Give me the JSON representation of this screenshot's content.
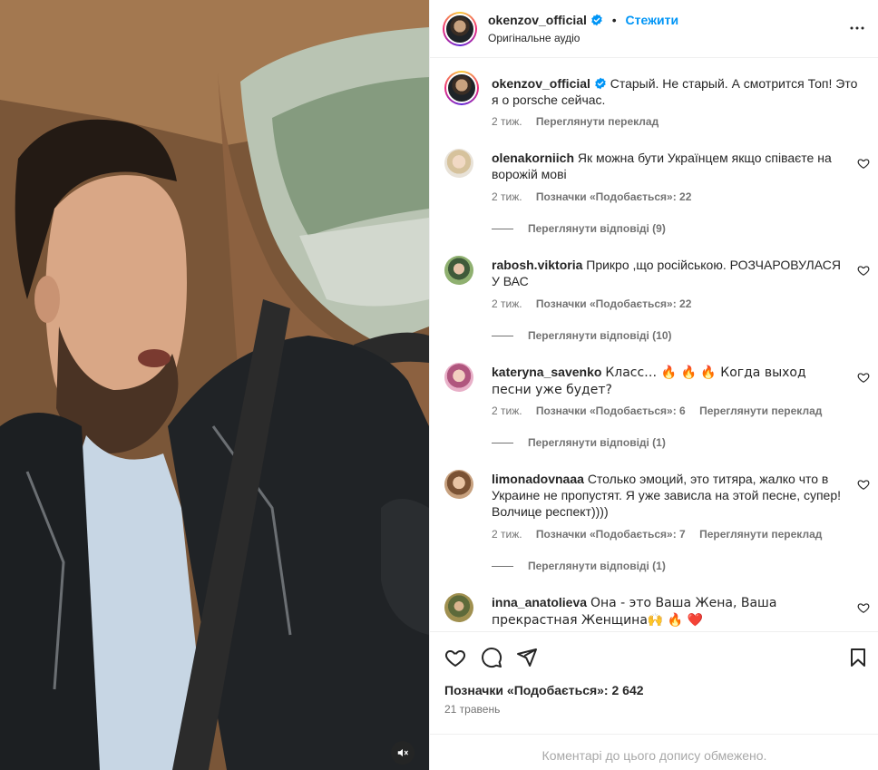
{
  "post": {
    "author": "okenzov_official",
    "follow_label": "Стежити",
    "audio_label": "Оригінальне аудіо"
  },
  "caption": {
    "username": "okenzov_official",
    "text": "Старый. Не старый. А смотрится Топ! Это я о porsche сейчас.",
    "time": "2 тиж.",
    "translate_label": "Переглянути переклад"
  },
  "comments": [
    {
      "username": "olenakorniich",
      "text": "Як можна бути Українцем якщо співаєте на ворожій мові",
      "time": "2 тиж.",
      "likes_label": "Позначки «Подобається»: 22",
      "translate_label": "",
      "replies_label": "Переглянути відповіді (9)",
      "avatar_color": "#d8c7b2"
    },
    {
      "username": "rabosh.viktoria",
      "text": "Прикро ,що російською. РОЗЧАРОВУЛАСЯ У ВАС",
      "time": "2 тиж.",
      "likes_label": "Позначки «Подобається»: 22",
      "translate_label": "",
      "replies_label": "Переглянути відповіді (10)",
      "avatar_color": "#7a9a5a"
    },
    {
      "username": "kateryna_savenko",
      "text": "Класс… 🔥 🔥 🔥 Когда выход песни уже будет?",
      "time": "2 тиж.",
      "likes_label": "Позначки «Подобається»: 6",
      "translate_label": "Переглянути переклад",
      "replies_label": "Переглянути відповіді (1)",
      "avatar_color": "#c98aa8"
    },
    {
      "username": "limonadovnaaa",
      "text": "Столько эмоций, это титяра, жалко что в Украине не пропустят. Я уже зависла на этой песне, супер! Волчице респект))))",
      "time": "2 тиж.",
      "likes_label": "Позначки «Подобається»: 7",
      "translate_label": "Переглянути переклад",
      "replies_label": "Переглянути відповіді (1)",
      "avatar_color": "#b08a6a"
    },
    {
      "username": "inna_anatolieva",
      "text": "Она - это Ваша Жена, Ваша прекрастная Женщина🙌 🔥 ❤️",
      "avatar_color": "#8a7a4a"
    }
  ],
  "actions": {
    "likes_text": "Позначки «Подобається»: 2 642",
    "date": "21 травень",
    "comments_restricted": "Коментарі до цього допису обмежено."
  },
  "icons": {
    "verified": "verified-badge-icon",
    "more": "more-horizontal-icon",
    "like": "heart-icon",
    "comment": "comment-bubble-icon",
    "share": "send-paper-plane-icon",
    "save": "bookmark-icon",
    "mute": "speaker-muted-icon"
  },
  "colors": {
    "accent": "#0095f6",
    "text_primary": "#262626",
    "text_secondary": "#737373",
    "heart_red": "#ed4956"
  }
}
